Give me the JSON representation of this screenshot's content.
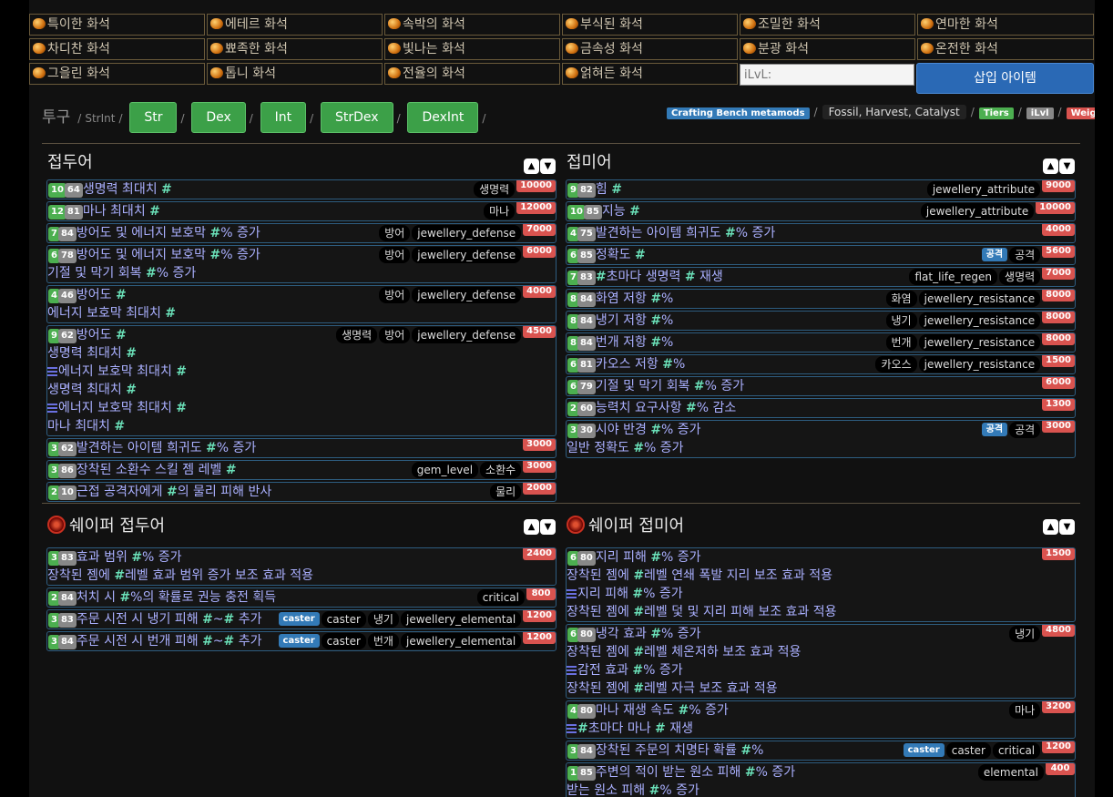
{
  "fossils": [
    "특이한 화석",
    "에테르 화석",
    "속박의 화석",
    "부식된 화석",
    "조밀한 화석",
    "연마한 화석",
    "차디찬 화석",
    "뾰족한 화석",
    "빛나는 화석",
    "금속성 화석",
    "분광 화석",
    "온전한 화석",
    "그을린 화석",
    "톱니 화석",
    "전율의 화석",
    "얽혀든 화석"
  ],
  "ilvl_placeholder": "iLvL:",
  "insert_label": "삽입 아이템",
  "filter": {
    "label": "투구",
    "strint": "StrInt",
    "buttons": [
      "Str",
      "Dex",
      "Int",
      "StrDex",
      "DexInt"
    ]
  },
  "legend": {
    "bench": "Crafting Bench metamods",
    "fossil": "Fossil, Harvest, Catalyst",
    "tiers": "Tiers",
    "ilvl": "iLvl",
    "weights": "Weights"
  },
  "colors": {
    "bench": "#337ab7",
    "tiers": "#4caf50",
    "ilvl": "#888888",
    "weights": "#d9534f"
  },
  "sections": {
    "prefix": "접두어",
    "suffix": "접미어",
    "shaper_prefix": "쉐이퍼 접두어",
    "shaper_suffix": "쉐이퍼 접미어"
  },
  "prefix_mods": [
    {
      "lv": "10",
      "tier": "64",
      "lines": [
        [
          "생명력 최대치 #"
        ]
      ],
      "tags": [
        "생명력"
      ],
      "btags": [],
      "weight": "10000"
    },
    {
      "lv": "12",
      "tier": "81",
      "lines": [
        [
          "마나 최대치 #"
        ]
      ],
      "tags": [
        "마나"
      ],
      "btags": [],
      "weight": "12000"
    },
    {
      "lv": "7",
      "tier": "84",
      "lines": [
        [
          "방어도 및 에너지 보호막 #% 증가"
        ]
      ],
      "tags": [
        "방어",
        "jewellery_defense"
      ],
      "btags": [],
      "weight": "7000"
    },
    {
      "lv": "6",
      "tier": "78",
      "lines": [
        [
          "방어도 및 에너지 보호막 #% 증가"
        ],
        [
          "기절 및 막기 회복 #% 증가"
        ]
      ],
      "tags": [
        "방어",
        "jewellery_defense"
      ],
      "btags": [],
      "weight": "6000"
    },
    {
      "lv": "4",
      "tier": "46",
      "lines": [
        [
          "방어도 #"
        ],
        [
          "에너지 보호막 최대치 #"
        ]
      ],
      "tags": [
        "방어",
        "jewellery_defense"
      ],
      "btags": [],
      "weight": "4000"
    },
    {
      "lv": "9",
      "tier": "62",
      "lines": [
        [
          "방어도 #"
        ],
        [
          "생명력 최대치 #"
        ],
        [
          "에너지 보호막 최대치 #",
          "list"
        ],
        [
          "생명력 최대치 #"
        ],
        [
          "에너지 보호막 최대치 #",
          "list"
        ],
        [
          "마나 최대치 #"
        ]
      ],
      "tags": [
        "생명력",
        "방어",
        "jewellery_defense"
      ],
      "btags": [],
      "weight": "4500"
    },
    {
      "lv": "3",
      "tier": "62",
      "lines": [
        [
          "발견하는 아이템 희귀도 #% 증가"
        ]
      ],
      "tags": [],
      "btags": [],
      "weight": "3000"
    },
    {
      "lv": "3",
      "tier": "86",
      "lines": [
        [
          "장착된 소환수 스킬 젬 레벨 #"
        ]
      ],
      "tags": [
        "gem_level",
        "소환수"
      ],
      "btags": [],
      "weight": "3000"
    },
    {
      "lv": "2",
      "tier": "10",
      "lines": [
        [
          "근접 공격자에게 #의 물리 피해 반사"
        ]
      ],
      "tags": [
        "물리"
      ],
      "btags": [],
      "weight": "2000"
    }
  ],
  "suffix_mods": [
    {
      "lv": "9",
      "tier": "82",
      "lines": [
        [
          "힘 #"
        ]
      ],
      "tags": [
        "jewellery_attribute"
      ],
      "btags": [],
      "weight": "9000"
    },
    {
      "lv": "10",
      "tier": "85",
      "lines": [
        [
          "지능 #"
        ]
      ],
      "tags": [
        "jewellery_attribute"
      ],
      "btags": [],
      "weight": "10000"
    },
    {
      "lv": "4",
      "tier": "75",
      "lines": [
        [
          "발견하는 아이템 희귀도 #% 증가"
        ]
      ],
      "tags": [],
      "btags": [],
      "weight": "4000"
    },
    {
      "lv": "6",
      "tier": "85",
      "lines": [
        [
          "정확도 #"
        ]
      ],
      "tags": [
        "공격"
      ],
      "btags": [
        "공격"
      ],
      "weight": "5600"
    },
    {
      "lv": "7",
      "tier": "83",
      "lines": [
        [
          "#초마다 생명력 # 재생"
        ]
      ],
      "tags": [
        "flat_life_regen",
        "생명력"
      ],
      "btags": [],
      "weight": "7000"
    },
    {
      "lv": "8",
      "tier": "84",
      "lines": [
        [
          "화염 저항 #%"
        ]
      ],
      "tags": [
        "화염",
        "jewellery_resistance"
      ],
      "btags": [],
      "weight": "8000"
    },
    {
      "lv": "8",
      "tier": "84",
      "lines": [
        [
          "냉기 저항 #%"
        ]
      ],
      "tags": [
        "냉기",
        "jewellery_resistance"
      ],
      "btags": [],
      "weight": "8000"
    },
    {
      "lv": "8",
      "tier": "84",
      "lines": [
        [
          "번개 저항 #%"
        ]
      ],
      "tags": [
        "번개",
        "jewellery_resistance"
      ],
      "btags": [],
      "weight": "8000"
    },
    {
      "lv": "6",
      "tier": "81",
      "lines": [
        [
          "카오스 저항 #%"
        ]
      ],
      "tags": [
        "카오스",
        "jewellery_resistance"
      ],
      "btags": [],
      "weight": "1500"
    },
    {
      "lv": "6",
      "tier": "79",
      "lines": [
        [
          "기절 및 막기 회복 #% 증가"
        ]
      ],
      "tags": [],
      "btags": [],
      "weight": "6000"
    },
    {
      "lv": "2",
      "tier": "60",
      "lines": [
        [
          "능력치 요구사항 #% 감소"
        ]
      ],
      "tags": [],
      "btags": [],
      "weight": "1300"
    },
    {
      "lv": "3",
      "tier": "30",
      "lines": [
        [
          "시야 반경 #% 증가"
        ],
        [
          "일반 정확도 #% 증가"
        ]
      ],
      "tags": [
        "공격"
      ],
      "btags": [
        "공격"
      ],
      "weight": "3000"
    }
  ],
  "shaper_prefix_mods": [
    {
      "lv": "3",
      "tier": "83",
      "lines": [
        [
          "효과 범위 #% 증가"
        ],
        [
          "장착된 젬에 #레벨 효과 범위 증가 보조 효과 적용"
        ]
      ],
      "tags": [],
      "btags": [],
      "weight": "2400"
    },
    {
      "lv": "2",
      "tier": "84",
      "lines": [
        [
          "처치 시 #%의 확률로 권능 충전 획득"
        ]
      ],
      "tags": [
        "critical"
      ],
      "btags": [],
      "weight": "800"
    },
    {
      "lv": "3",
      "tier": "83",
      "lines": [
        [
          "주문 시전 시 냉기 피해 #~# 추가"
        ]
      ],
      "tags": [
        "caster",
        "냉기",
        "jewellery_elemental"
      ],
      "btags": [
        "caster"
      ],
      "weight": "1200"
    },
    {
      "lv": "3",
      "tier": "84",
      "lines": [
        [
          "주문 시전 시 번개 피해 #~# 추가"
        ]
      ],
      "tags": [
        "caster",
        "번개",
        "jewellery_elemental"
      ],
      "btags": [
        "caster"
      ],
      "weight": "1200"
    }
  ],
  "shaper_suffix_mods": [
    {
      "lv": "6",
      "tier": "80",
      "lines": [
        [
          "지리 피해 #% 증가"
        ],
        [
          "장착된 젬에 #레벨 연쇄 폭발 지리 보조 효과 적용"
        ],
        [
          "지리 피해 #% 증가",
          "list"
        ],
        [
          "장착된 젬에 #레벨 덫 및 지리 피해 보조 효과 적용"
        ]
      ],
      "tags": [],
      "btags": [],
      "weight": "1500"
    },
    {
      "lv": "6",
      "tier": "80",
      "lines": [
        [
          "냉각 효과 #% 증가"
        ],
        [
          "장착된 젬에 #레벨 체온저하 보조 효과 적용"
        ],
        [
          "감전 효과 #% 증가",
          "list"
        ],
        [
          "장착된 젬에 #레벨 자극 보조 효과 적용"
        ]
      ],
      "tags": [
        "냉기"
      ],
      "btags": [],
      "weight": "4800"
    },
    {
      "lv": "4",
      "tier": "80",
      "lines": [
        [
          "마나 재생 속도 #% 증가"
        ],
        [
          "#초마다 마나 # 재생",
          "list"
        ]
      ],
      "tags": [
        "마나"
      ],
      "btags": [],
      "weight": "3200"
    },
    {
      "lv": "3",
      "tier": "84",
      "lines": [
        [
          "장착된 주문의 치명타 확률 #%"
        ]
      ],
      "tags": [
        "caster",
        "critical"
      ],
      "btags": [
        "caster"
      ],
      "weight": "1200"
    },
    {
      "lv": "1",
      "tier": "85",
      "lines": [
        [
          "주변의 적이 받는 원소 피해 #% 증가"
        ],
        [
          "받는 원소 피해 #% 증가"
        ]
      ],
      "tags": [
        "elemental"
      ],
      "btags": [],
      "weight": "400"
    }
  ]
}
